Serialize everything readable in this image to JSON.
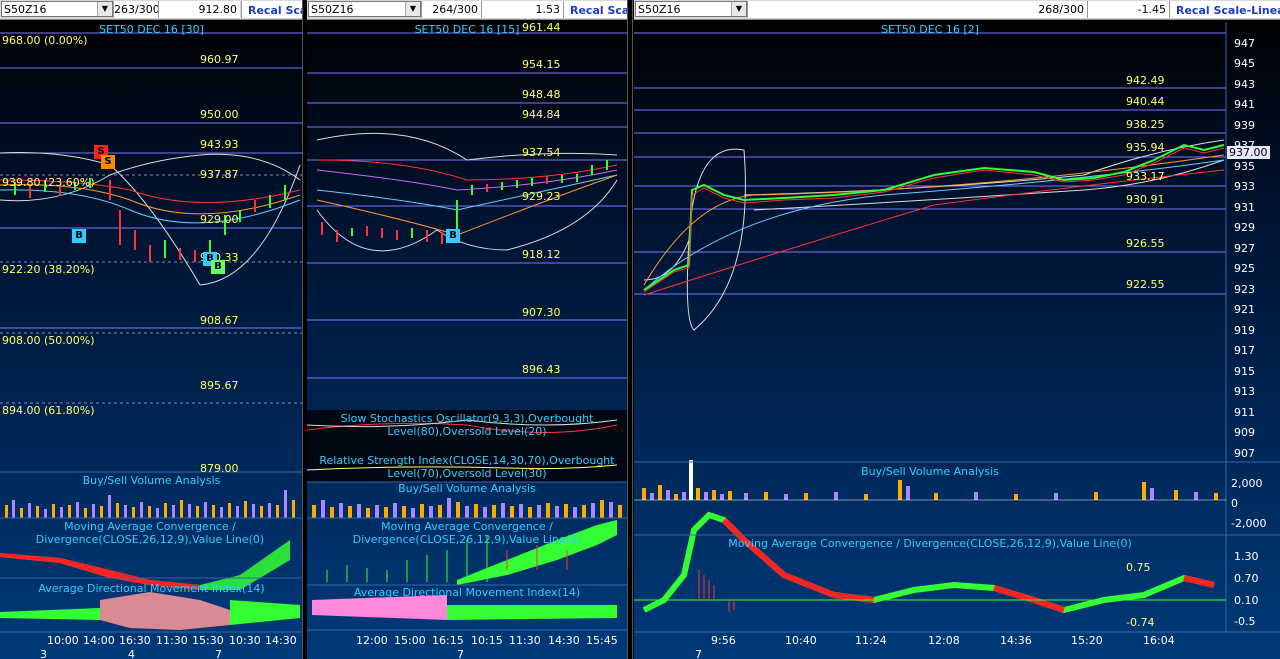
{
  "panes": [
    {
      "symbol": "S50Z16",
      "counter": "263/300",
      "price": "912.80",
      "recal": "Recal Scale",
      "title": "SET50 DEC 16  [30]",
      "fib_levels": [
        "968.00 (0.00%)",
        "939.80 (23.60%)",
        "922.20 (38.20%)",
        "908.00 (50.00%)",
        "894.00 (61.80%)"
      ],
      "levels": [
        "960.97",
        "950.00",
        "943.93",
        "937.87",
        "929.00",
        "920.33",
        "908.67",
        "895.67",
        "879.00"
      ],
      "volume_title": "Buy/Sell Volume Analysis",
      "macd_title": "Moving Average Convergence / Divergence(CLOSE,26,12,9),Value Line(0)",
      "adx_title": "Average Directional Movement Index(14)",
      "times": [
        "10:00",
        "14:00",
        "16:30",
        "11:30",
        "15:30",
        "10:30",
        "14:30"
      ],
      "days": [
        "3",
        "4",
        "7"
      ],
      "markers": [
        "S",
        "S",
        "B",
        "B",
        "B"
      ]
    },
    {
      "symbol": "S50Z16",
      "counter": "264/300",
      "price": "1.53",
      "recal": "Recal Scale",
      "title": "SET50 DEC 16  [15]",
      "levels": [
        "961.44",
        "954.15",
        "948.48",
        "944.84",
        "937.54",
        "929.23",
        "918.12",
        "907.30",
        "896.43"
      ],
      "stoch_title": "Slow Stochastics Oscillator(9,3,3),Overbought Level(80),Oversold Level(20)",
      "rsi_title": "Relative Strength Index(CLOSE,14,30,70),Overbought Level(70),Oversold Level(30)",
      "volume_title": "Buy/Sell Volume Analysis",
      "macd_title": "Moving Average Convergence / Divergence(CLOSE,26,12,9),Value Line(0)",
      "adx_title": "Average Directional Movement Index(14)",
      "times": [
        "12:00",
        "15:00",
        "16:15",
        "10:15",
        "11:30",
        "14:30",
        "15:45"
      ],
      "days": [
        "7"
      ],
      "markers": [
        "B"
      ]
    },
    {
      "symbol": "S50Z16",
      "counter": "268/300",
      "price": "-1.45",
      "recal": "Recal Scale-Linear",
      "title": "SET50 DEC 16  [2]",
      "levels": [
        "942.49",
        "940.44",
        "938.25",
        "935.94",
        "933.17",
        "930.91",
        "926.55",
        "922.55"
      ],
      "last_price": "937.00",
      "yaxis": [
        "947",
        "945",
        "943",
        "941",
        "939",
        "937",
        "935",
        "933",
        "931",
        "929",
        "927",
        "925",
        "923",
        "921",
        "919",
        "917",
        "915",
        "913",
        "911",
        "909",
        "907"
      ],
      "volume_title": "Buy/Sell Volume Analysis",
      "volume_axis": [
        "2,000",
        "0",
        "-2,000"
      ],
      "macd_title": "Moving Average Convergence / Divergence(CLOSE,26,12,9),Value Line(0)",
      "macd_levels": [
        "0.75",
        "-0.74"
      ],
      "macd_axis": [
        "1.30",
        "0.70",
        "0.10",
        "-0.5"
      ],
      "times": [
        "9:56",
        "10:40",
        "11:24",
        "12:08",
        "14:36",
        "15:20",
        "16:04"
      ],
      "days": [
        "7"
      ]
    }
  ],
  "colors": {
    "level": "#ffff66",
    "title": "#33ccff",
    "bull": "#33ff33",
    "bear": "#ff2222"
  }
}
